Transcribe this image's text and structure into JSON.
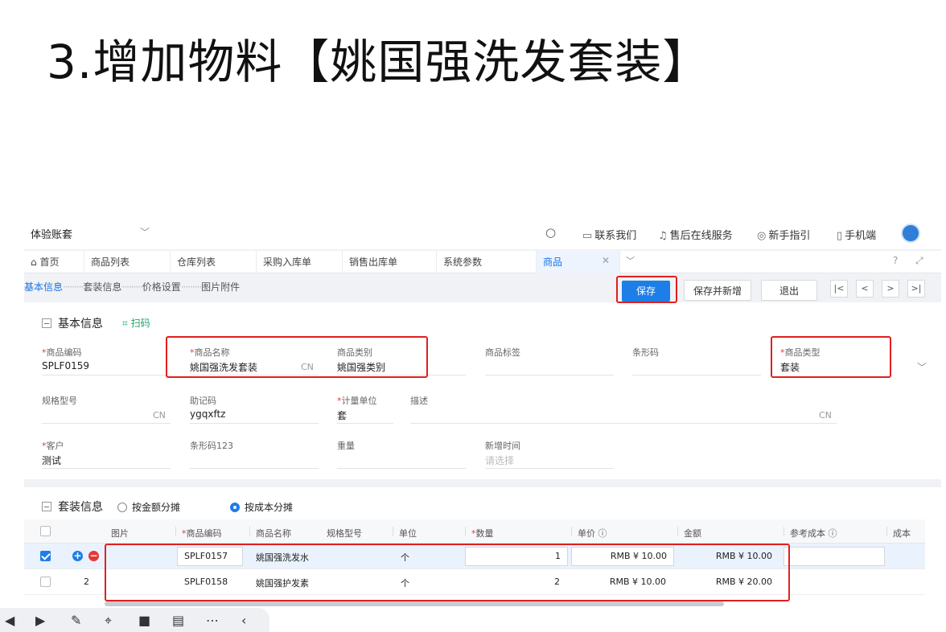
{
  "slide": {
    "title": "3.增加物料【姚国强洗发套装】"
  },
  "topbar": {
    "account": "体验账套",
    "links": [
      {
        "icon": "chat-icon",
        "glyph": "▭",
        "label": "联系我们"
      },
      {
        "icon": "headset-icon",
        "glyph": "♫",
        "label": "售后在线服务"
      },
      {
        "icon": "compass-icon",
        "glyph": "◎",
        "label": "新手指引"
      },
      {
        "icon": "phone-icon",
        "glyph": "▯",
        "label": "手机端"
      }
    ]
  },
  "tabs": {
    "home": "首页",
    "items": [
      "商品列表",
      "仓库列表",
      "采购入库单",
      "销售出库单",
      "系统参数"
    ],
    "active": "商品"
  },
  "steps": [
    "基本信息",
    "套装信息",
    "价格设置",
    "图片附件"
  ],
  "actions": {
    "save": "保存",
    "save_new": "保存并新增",
    "exit": "退出"
  },
  "basic": {
    "title": "基本信息",
    "scan": "扫码",
    "fields": {
      "code": {
        "label": "商品编码",
        "value": "SPLF0159"
      },
      "name": {
        "label": "商品名称",
        "value": "姚国强洗发套装",
        "lang": "CN"
      },
      "category": {
        "label": "商品类别",
        "value": "姚国强类别"
      },
      "tag": {
        "label": "商品标签",
        "value": ""
      },
      "barcode": {
        "label": "条形码",
        "value": ""
      },
      "type": {
        "label": "商品类型",
        "value": "套装"
      },
      "spec": {
        "label": "规格型号",
        "value": "",
        "lang": "CN"
      },
      "mnemonic": {
        "label": "助记码",
        "value": "ygqxftz"
      },
      "unit": {
        "label": "计量单位",
        "value": "套"
      },
      "desc": {
        "label": "描述",
        "value": "",
        "lang": "CN"
      },
      "customer": {
        "label": "客户",
        "value": "测试"
      },
      "barcode123": {
        "label": "条形码123",
        "value": ""
      },
      "weight": {
        "label": "重量",
        "value": ""
      },
      "created": {
        "label": "新增时间",
        "placeholder": "请选择"
      }
    }
  },
  "kit": {
    "title": "套装信息",
    "options": [
      "按金额分摊",
      "按成本分摊"
    ],
    "selected": "按成本分摊",
    "columns": [
      "图片",
      "商品编码",
      "商品名称",
      "规格型号",
      "单位",
      "数量",
      "单价",
      "金额",
      "参考成本",
      "成本"
    ],
    "rows": [
      {
        "index": "",
        "code": "SPLF0157",
        "name": "姚国强洗发水",
        "spec": "",
        "unit": "个",
        "qty": "1",
        "price": "RMB ¥ 10.00",
        "amount": "RMB ¥ 10.00",
        "checked": true
      },
      {
        "index": "2",
        "code": "SPLF0158",
        "name": "姚国强护发素",
        "spec": "",
        "unit": "个",
        "qty": "2",
        "price": "RMB ¥ 10.00",
        "amount": "RMB ¥ 20.00",
        "checked": false
      }
    ]
  },
  "colors": {
    "primary": "#1e7ee8",
    "highlight": "#e02020",
    "required": "#e53935"
  }
}
